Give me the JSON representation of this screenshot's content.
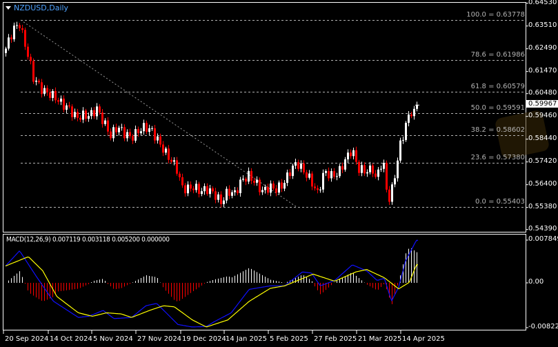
{
  "header": {
    "symbol_title": "NZDUSD,Daily"
  },
  "chart_data": [
    {
      "type": "candlestick",
      "title": "NZDUSD,Daily",
      "ylim": [
        0.5439,
        0.6453
      ],
      "y_ticks": [
        "0.64530",
        "0.63510",
        "0.62490",
        "0.61470",
        "0.60480",
        "0.59460",
        "0.58440",
        "0.57420",
        "0.56400",
        "0.55380",
        "0.54390"
      ],
      "x_ticks": [
        "20 Sep 2024",
        "14 Oct 2024",
        "5 Nov 2024",
        "27 Nov 2024",
        "19 Dec 2024",
        "14 Jan 2025",
        "5 Feb 2025",
        "27 Feb 2025",
        "21 Mar 2025",
        "14 Apr 2025"
      ],
      "current_price": "0.59967",
      "current_price_value": 0.59967,
      "bar_count": 150,
      "close_waypoints": [
        [
          0,
          0.625
        ],
        [
          1.5,
          0.63
        ],
        [
          3,
          0.634
        ],
        [
          5,
          0.636
        ],
        [
          6.7,
          0.628
        ],
        [
          8.5,
          0.62
        ],
        [
          10,
          0.612
        ],
        [
          11.7,
          0.609
        ],
        [
          13.5,
          0.606
        ],
        [
          15.5,
          0.605
        ],
        [
          18,
          0.603
        ],
        [
          20.5,
          0.6
        ],
        [
          23,
          0.598
        ],
        [
          25.5,
          0.594
        ],
        [
          28,
          0.595
        ],
        [
          30.5,
          0.595
        ],
        [
          33,
          0.598
        ],
        [
          35.5,
          0.592
        ],
        [
          38,
          0.586
        ],
        [
          40.5,
          0.59
        ],
        [
          43,
          0.587
        ],
        [
          45.5,
          0.585
        ],
        [
          48,
          0.588
        ],
        [
          50.5,
          0.59
        ],
        [
          53,
          0.588
        ],
        [
          55.5,
          0.583
        ],
        [
          58,
          0.578
        ],
        [
          60.5,
          0.574
        ],
        [
          62.5,
          0.57
        ],
        [
          63.5,
          0.563
        ],
        [
          65.5,
          0.562
        ],
        [
          68,
          0.563
        ],
        [
          70.5,
          0.561
        ],
        [
          73,
          0.562
        ],
        [
          75.5,
          0.56
        ],
        [
          78,
          0.556
        ],
        [
          80.5,
          0.561
        ],
        [
          83,
          0.56
        ],
        [
          85.5,
          0.566
        ],
        [
          88,
          0.568
        ],
        [
          90.5,
          0.565
        ],
        [
          93,
          0.561
        ],
        [
          95.5,
          0.563
        ],
        [
          98,
          0.562
        ],
        [
          100.5,
          0.564
        ],
        [
          103,
          0.57
        ],
        [
          105.5,
          0.574
        ],
        [
          108,
          0.57
        ],
        [
          110.5,
          0.566
        ],
        [
          113,
          0.56
        ],
        [
          115.5,
          0.57
        ],
        [
          118,
          0.568
        ],
        [
          120.5,
          0.569
        ],
        [
          123,
          0.575
        ],
        [
          125.5,
          0.58
        ],
        [
          126.7,
          0.575
        ],
        [
          128,
          0.571
        ],
        [
          130.5,
          0.57
        ],
        [
          133,
          0.571
        ],
        [
          134.2,
          0.566
        ],
        [
          135.5,
          0.572
        ],
        [
          136.7,
          0.575
        ],
        [
          138,
          0.562
        ],
        [
          139.2,
          0.557
        ],
        [
          140.5,
          0.565
        ],
        [
          141.7,
          0.573
        ],
        [
          143,
          0.582
        ],
        [
          144.2,
          0.587
        ],
        [
          145.5,
          0.593
        ],
        [
          146.7,
          0.597
        ],
        [
          148,
          0.596
        ],
        [
          149,
          0.5997
        ]
      ],
      "fibonacci": {
        "levels": [
          {
            "label": "100.0 = 0.63778",
            "value": 0.63778
          },
          {
            "label": "78.6 = 0.61986",
            "value": 0.61986
          },
          {
            "label": "61.8 = 0.60579",
            "value": 0.60579
          },
          {
            "label": "50.0 = 0.59591",
            "value": 0.59591
          },
          {
            "label": "38.2 = 0.58602",
            "value": 0.58602
          },
          {
            "label": "23.6 = 0.57380",
            "value": 0.5738
          },
          {
            "label": "0.0 = 0.55403",
            "value": 0.55403
          }
        ]
      }
    },
    {
      "type": "line",
      "title": "MACD(12,26,9) 0.007119 0.003118 0.005200 0.000000",
      "ylim": [
        -0.008222,
        0.007849
      ],
      "y_ticks": [
        "0.007849",
        "0.00",
        "-0.008222"
      ],
      "series": [
        {
          "name": "MACD",
          "color": "#1010ff",
          "points": [
            [
              0,
              0.00309
            ],
            [
              5.1,
              0.00588
            ],
            [
              10.9,
              0.00138
            ],
            [
              17.3,
              -0.00335
            ],
            [
              26.4,
              -0.00635
            ],
            [
              30.2,
              -0.00613
            ],
            [
              35.4,
              -0.00506
            ],
            [
              39.3,
              -0.00656
            ],
            [
              45.7,
              -0.00635
            ],
            [
              50.9,
              -0.0042
            ],
            [
              54.8,
              -0.00378
            ],
            [
              62.5,
              -0.00764
            ],
            [
              67.7,
              -0.0081
            ],
            [
              72.8,
              -0.008
            ],
            [
              75.4,
              -0.0072
            ],
            [
              81.8,
              -0.0055
            ],
            [
              88.3,
              -0.0012
            ],
            [
              96,
              -0.00055
            ],
            [
              101.2,
              -0.00055
            ],
            [
              107.6,
              0.002
            ],
            [
              110.9,
              0.0018
            ],
            [
              114.1,
              -0.00055
            ],
            [
              119.3,
              0.00043
            ],
            [
              125.7,
              0.0033
            ],
            [
              130.9,
              0.0022
            ],
            [
              134.7,
              0.00043
            ],
            [
              137.3,
              0.00086
            ],
            [
              139.9,
              -0.00335
            ],
            [
              142.5,
              -0.0008
            ],
            [
              145,
              0.004
            ],
            [
              148.9,
              0.0078
            ]
          ]
        },
        {
          "name": "Signal",
          "color": "#ffff00",
          "points": [
            [
              0,
              0.00309
            ],
            [
              8.3,
              0.0048
            ],
            [
              13.5,
              0.0022
            ],
            [
              18.6,
              -0.0025
            ],
            [
              26.4,
              -0.0055
            ],
            [
              31.5,
              -0.00613
            ],
            [
              36.7,
              -0.0055
            ],
            [
              41.9,
              -0.0057
            ],
            [
              45.7,
              -0.00635
            ],
            [
              52.2,
              -0.00506
            ],
            [
              57.3,
              -0.0042
            ],
            [
              61.2,
              -0.0044
            ],
            [
              67.7,
              -0.0068
            ],
            [
              72.8,
              -0.0081
            ],
            [
              80.6,
              -0.0068
            ],
            [
              88.3,
              -0.0034
            ],
            [
              96,
              -0.001
            ],
            [
              101.2,
              -0.00055
            ],
            [
              111.5,
              0.0016
            ],
            [
              119.3,
              0.0003
            ],
            [
              127,
              0.002
            ],
            [
              130.9,
              0.00245
            ],
            [
              137.3,
              0.00094
            ],
            [
              142.5,
              -0.0011
            ],
            [
              146.4,
              0.0001
            ],
            [
              148.9,
              0.0033
            ]
          ]
        }
      ],
      "histogram": {
        "name": "Histogram",
        "positive_color": "#ffffff",
        "negative_color": "#ff0000"
      }
    }
  ]
}
